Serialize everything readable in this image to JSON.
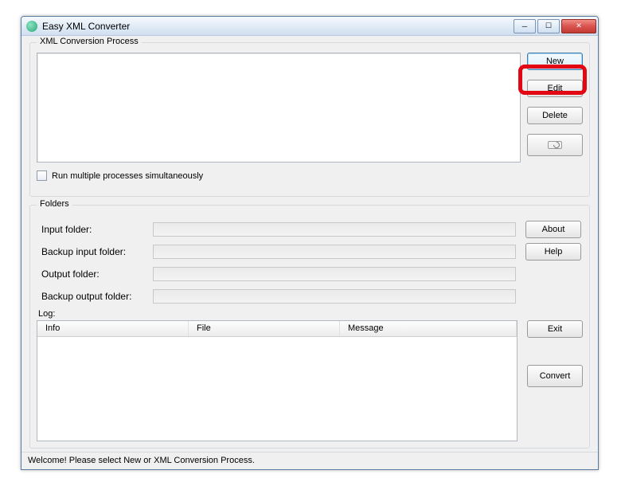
{
  "window": {
    "title": "Easy XML Converter"
  },
  "process": {
    "group_label": "XML Conversion Process",
    "buttons": {
      "new": "New",
      "edit": "Edit",
      "delete": "Delete"
    },
    "checkbox_label": "Run multiple processes simultaneously"
  },
  "folders": {
    "group_label": "Folders",
    "rows": {
      "input": "Input folder:",
      "backup_input": "Backup input folder:",
      "output": "Output folder:",
      "backup_output": "Backup output folder:"
    },
    "buttons": {
      "about": "About",
      "help": "Help",
      "exit": "Exit",
      "convert": "Convert"
    },
    "log_label": "Log:",
    "log_columns": {
      "info": "Info",
      "file": "File",
      "message": "Message"
    }
  },
  "status": "Welcome! Please select New or XML Conversion Process."
}
